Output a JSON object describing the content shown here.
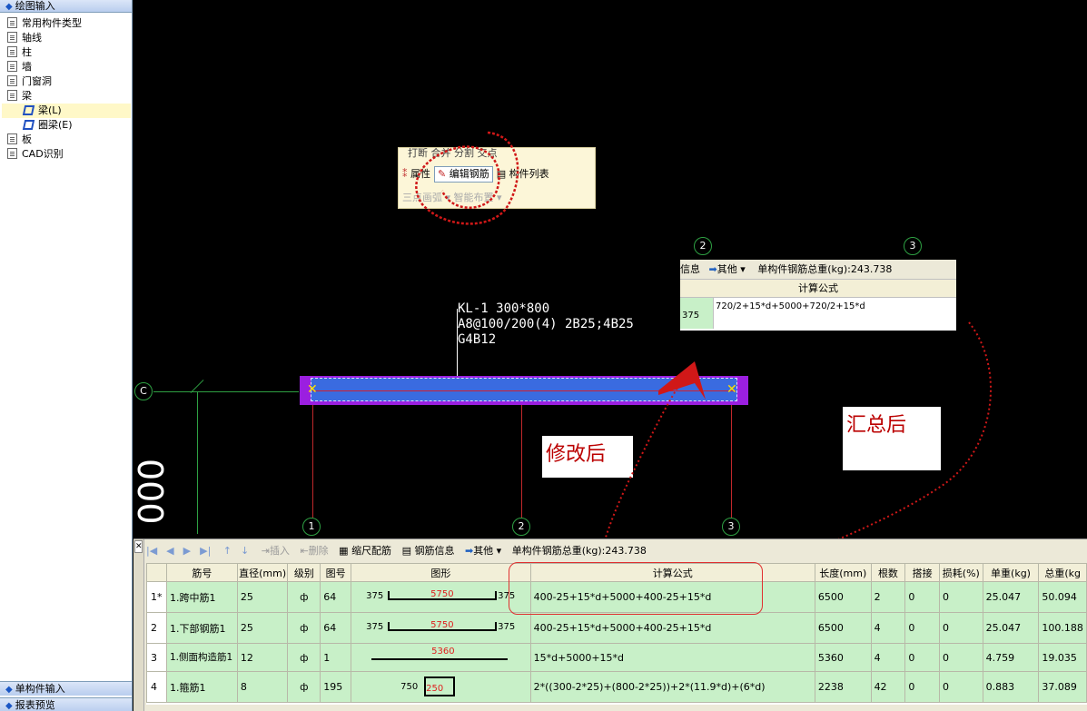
{
  "left_panel": {
    "header": "绘图输入",
    "items": [
      "常用构件类型",
      "轴线",
      "柱",
      "墙",
      "门窗洞",
      "梁",
      "梁(L)",
      "圈梁(E)",
      "板",
      "CAD识别"
    ],
    "footer1": "单构件输入",
    "footer2": "报表预览"
  },
  "canvas": {
    "axis_labels": {
      "top2": "2",
      "top3": "3",
      "c": "C",
      "b1": "1",
      "b2": "2",
      "b3": "3"
    },
    "beam_label_line1": "KL-1 300*800",
    "beam_label_line2": "A8@100/200(4) 2B25;4B25",
    "beam_label_line3": "G4B12",
    "big_zeros": "000",
    "snip_toolbar": {
      "row1": "打断  合并  分割  交点",
      "attr": "属性",
      "edit_rebar": "编辑钢筋",
      "comp_list": "构件列表",
      "row3": "三点画弧 ▾     智能布置 ▾"
    },
    "formula_snip": {
      "info": "信息",
      "other": "其他",
      "total_label": "单构件钢筋总重(kg):243.738",
      "header": "计算公式",
      "left_val": "375",
      "formula": "720/2+15*d+5000+720/2+15*d"
    },
    "note_modified": "修改后",
    "note_summary": "汇总后"
  },
  "bottom_toolbar": {
    "insert": "插入",
    "delete": "删除",
    "scale": "缩尺配筋",
    "rebar_info": "钢筋信息",
    "other": "其他",
    "total": "单构件钢筋总重(kg):243.738"
  },
  "table": {
    "headers": [
      "",
      "筋号",
      "直径(mm)",
      "级别",
      "图号",
      "图形",
      "计算公式",
      "长度(mm)",
      "根数",
      "搭接",
      "损耗(%)",
      "单重(kg)",
      "总重(kg"
    ],
    "rows": [
      {
        "rn": "1*",
        "name": "1.跨中筋1",
        "dia": "25",
        "grade": "ф",
        "fig": "64",
        "s_left": "375",
        "s_mid": "5750",
        "s_right": "375",
        "formula": "400-25+15*d+5000+400-25+15*d",
        "len": "6500",
        "count": "2",
        "lap": "0",
        "loss": "0",
        "unit": "25.047",
        "total": "50.094"
      },
      {
        "rn": "2",
        "name": "1.下部钢筋1",
        "dia": "25",
        "grade": "ф",
        "fig": "64",
        "s_left": "375",
        "s_mid": "5750",
        "s_right": "375",
        "formula": "400-25+15*d+5000+400-25+15*d",
        "len": "6500",
        "count": "4",
        "lap": "0",
        "loss": "0",
        "unit": "25.047",
        "total": "100.188"
      },
      {
        "rn": "3",
        "name": "1.侧面构造筋1",
        "dia": "12",
        "grade": "ф",
        "fig": "1",
        "s_left": "",
        "s_mid": "5360",
        "s_right": "",
        "formula": "15*d+5000+15*d",
        "len": "5360",
        "count": "4",
        "lap": "0",
        "loss": "0",
        "unit": "4.759",
        "total": "19.035"
      },
      {
        "rn": "4",
        "name": "1.箍筋1",
        "dia": "8",
        "grade": "ф",
        "fig": "195",
        "s_left": "750",
        "s_mid": "250",
        "s_right": "",
        "formula": "2*((300-2*25)+(800-2*25))+2*(11.9*d)+(6*d)",
        "len": "2238",
        "count": "42",
        "lap": "0",
        "loss": "0",
        "unit": "0.883",
        "total": "37.089"
      }
    ]
  }
}
